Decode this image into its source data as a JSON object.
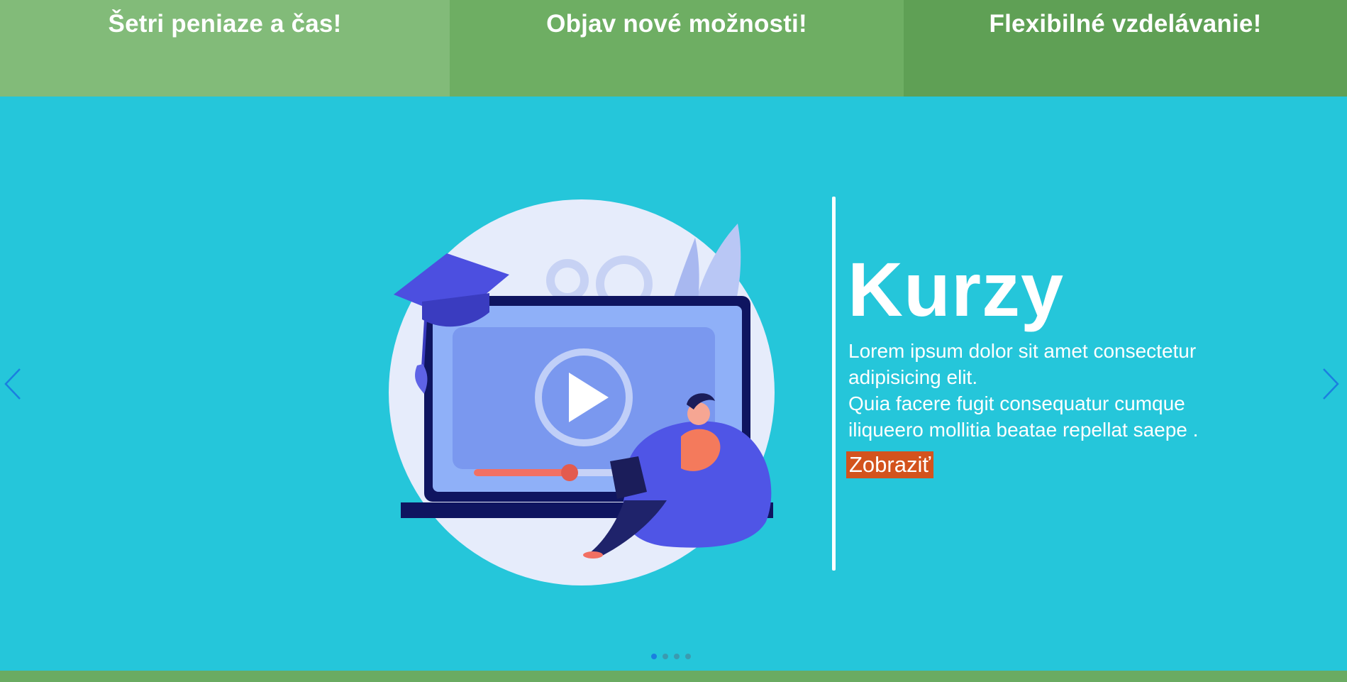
{
  "features": [
    {
      "label": "Šetri peniaze a čas!"
    },
    {
      "label": "Objav nové možnosti!"
    },
    {
      "label": "Flexibilné vzdelávanie!"
    }
  ],
  "slide": {
    "title": "Kurzy",
    "text_lines": [
      "Lorem ipsum dolor sit amet consectetur",
      "adipisicing elit.",
      "Quia facere fugit consequatur cumque",
      "iliqueero mollitia beatae repellat saepe ."
    ],
    "button_label": "Zobraziť"
  },
  "carousel": {
    "slide_count": 4,
    "active_index": 0,
    "prev_icon": "chevron-left-icon",
    "next_icon": "chevron-right-icon"
  },
  "colors": {
    "hero_bg": "#25c6da",
    "tile_1": "#82bb79",
    "tile_2": "#6eae63",
    "tile_3": "#5fa055",
    "button_bg": "#d3531d",
    "arrow": "#1a7fe0"
  }
}
